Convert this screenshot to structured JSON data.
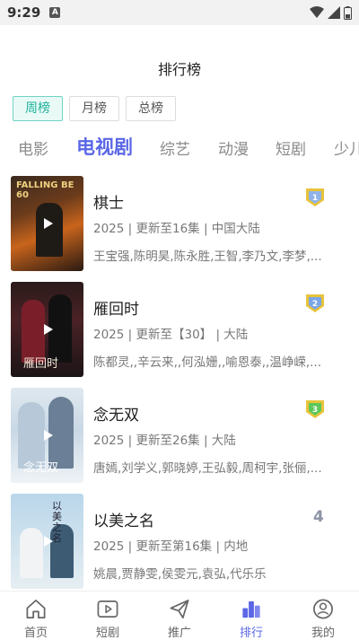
{
  "status_bar": {
    "time": "9:29",
    "notification": "A"
  },
  "page_title": "排行榜",
  "period_tabs": [
    {
      "label": "周榜",
      "active": true
    },
    {
      "label": "月榜",
      "active": false
    },
    {
      "label": "总榜",
      "active": false
    }
  ],
  "category_tabs": [
    {
      "label": "电影",
      "active": false
    },
    {
      "label": "电视剧",
      "active": true
    },
    {
      "label": "综艺",
      "active": false
    },
    {
      "label": "动漫",
      "active": false
    },
    {
      "label": "短剧",
      "active": false
    },
    {
      "label": "少儿",
      "active": false
    }
  ],
  "items": [
    {
      "title": "棋士",
      "meta": "2025 | 更新至16集 | 中国大陆",
      "cast": "王宝强,陈明昊,陈永胜,王智,李乃文,李梦,...",
      "rank": "1",
      "poster_text": "FALLING BE 60"
    },
    {
      "title": "雁回时",
      "meta": "2025 | 更新至【30】 | 大陆",
      "cast": "陈都灵,,辛云来,,何泓姗,,喻恩泰,,温峥嵘,...",
      "rank": "2",
      "poster_text": "雁回时"
    },
    {
      "title": "念无双",
      "meta": "2025 | 更新至26集 | 大陆",
      "cast": "唐嫣,刘学义,郭晓婷,王弘毅,周柯宇,张俪,...",
      "rank": "3",
      "poster_text": "念无双"
    },
    {
      "title": "以美之名",
      "meta": "2025 | 更新至第16集 | 内地",
      "cast": "姚晨,贾静雯,侯雯元,袁弘,代乐乐",
      "rank": "4",
      "poster_text": "以美之名"
    }
  ],
  "bottom_nav": [
    {
      "label": "首页",
      "icon": "home-icon",
      "active": false
    },
    {
      "label": "短剧",
      "icon": "play-box-icon",
      "active": false
    },
    {
      "label": "推广",
      "icon": "paper-plane-icon",
      "active": false
    },
    {
      "label": "排行",
      "icon": "rank-icon",
      "active": true
    },
    {
      "label": "我的",
      "icon": "user-icon",
      "active": false
    }
  ],
  "colors": {
    "accent": "#5b67e6",
    "period_active": "#1fb39c",
    "gold": "#e8c33a",
    "green_badge": "#5cc85a"
  }
}
